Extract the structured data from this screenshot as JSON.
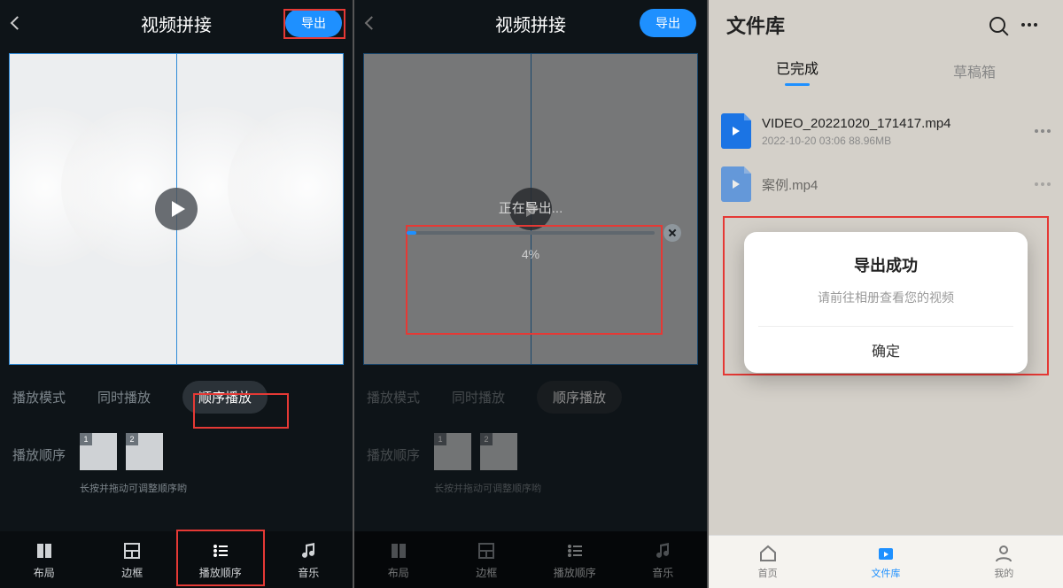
{
  "panel1": {
    "title": "视频拼接",
    "export_label": "导出",
    "play_mode_label": "播放模式",
    "mode_sync": "同时播放",
    "mode_seq": "顺序播放",
    "order_label": "播放顺序",
    "thumbs": [
      "1",
      "2"
    ],
    "drag_hint": "长按并拖动可调整顺序哟",
    "nav": {
      "layout": "布局",
      "border": "边框",
      "order": "播放顺序",
      "music": "音乐"
    }
  },
  "panel2": {
    "title": "视频拼接",
    "export_label": "导出",
    "progress_label": "正在导出...",
    "progress_percent": "4%",
    "progress_value": 4,
    "play_mode_label": "播放模式",
    "mode_sync": "同时播放",
    "mode_seq": "顺序播放",
    "order_label": "播放顺序",
    "thumbs": [
      "1",
      "2"
    ],
    "drag_hint": "长按并拖动可调整顺序哟",
    "nav": {
      "layout": "布局",
      "border": "边框",
      "order": "播放顺序",
      "music": "音乐"
    }
  },
  "panel3": {
    "title": "文件库",
    "tab_done": "已完成",
    "tab_draft": "草稿箱",
    "files": [
      {
        "name": "VIDEO_20221020_171417.mp4",
        "meta": "2022-10-20  03:06  88.96MB"
      },
      {
        "name": "案例.mp4",
        "meta": ""
      }
    ],
    "dialog": {
      "title": "导出成功",
      "msg": "请前往相册查看您的视频",
      "ok": "确定"
    },
    "tabbar": {
      "home": "首页",
      "lib": "文件库",
      "me": "我的"
    }
  }
}
